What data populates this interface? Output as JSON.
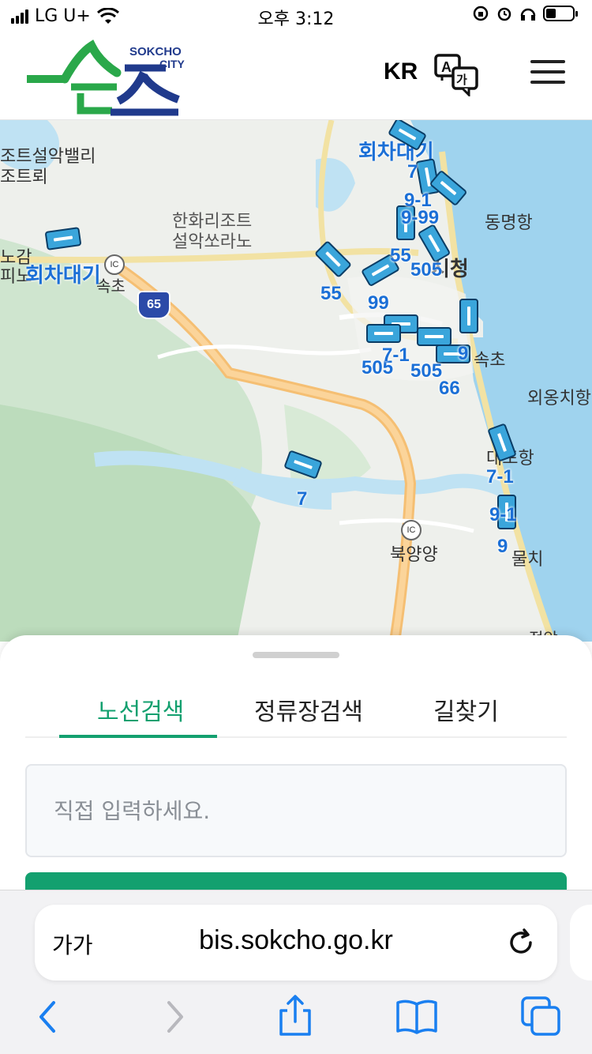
{
  "status_bar": {
    "carrier": "LG U+",
    "time": "오후 3:12"
  },
  "header": {
    "logo_top_text": "SOKCHO",
    "logo_sub_text": "CITY",
    "logo_main_text": "속초",
    "lang_label": "KR",
    "translate_icon": "translate-icon",
    "menu_icon": "hamburger-menu-icon"
  },
  "map": {
    "places": [
      {
        "text": "조트설악밸리",
        "kind": "place"
      },
      {
        "text": "조트뢰",
        "kind": "place"
      },
      {
        "text": "한화리조트",
        "kind": "place"
      },
      {
        "text": "설악쏘라노",
        "kind": "place"
      },
      {
        "text": "동명항",
        "kind": "place"
      },
      {
        "text": "시청",
        "kind": "place"
      },
      {
        "text": "속초",
        "kind": "place"
      },
      {
        "text": "외옹치항",
        "kind": "place"
      },
      {
        "text": "북양양",
        "kind": "place"
      },
      {
        "text": "노감",
        "kind": "place"
      },
      {
        "text": "피노",
        "kind": "place"
      },
      {
        "text": "속초",
        "kind": "place"
      },
      {
        "text": "물치",
        "kind": "place"
      },
      {
        "text": "정암",
        "kind": "place"
      },
      {
        "text": "대포항",
        "kind": "place"
      }
    ],
    "highway_shield": "65",
    "ic_labels": [
      "IC",
      "IC"
    ],
    "waiting_labels": [
      "회차대기",
      "회차대기"
    ],
    "routes": [
      "7",
      "9-1",
      "9-99",
      "55",
      "505",
      "99",
      "55",
      "9",
      "66",
      "505",
      "505",
      "7-1",
      "7",
      "7-1",
      "9-1",
      "9"
    ]
  },
  "sheet": {
    "tabs": [
      {
        "label": "노선검색",
        "active": true
      },
      {
        "label": "정류장검색",
        "active": false
      },
      {
        "label": "길찾기",
        "active": false
      }
    ],
    "search_placeholder": "직접 입력하세요.",
    "accent_color": "#13a06f"
  },
  "browser": {
    "text_size_label": "가가",
    "url": "bis.sokcho.go.kr",
    "icons": [
      "back-icon",
      "forward-icon",
      "share-icon",
      "bookmarks-icon",
      "tabs-icon",
      "reload-icon"
    ]
  }
}
